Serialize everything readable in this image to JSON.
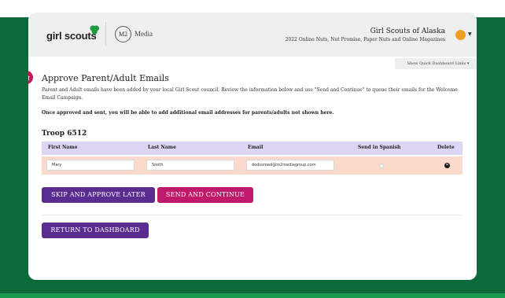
{
  "header": {
    "logo_text": "girl scouts",
    "partner_mark": "M2",
    "partner_name": "Media",
    "council": "Girl Scouts of Alaska",
    "sale_info": "2022 Online Nuts, Nut Promise, Paper Nuts and Online Magazines",
    "quick_links": "Show Quick Dashboard Links ▾"
  },
  "page": {
    "title": "Approve Parent/Adult Emails",
    "description": "Parent and Adult emails have been added by your local Girl Scout council. Review the information below and use \"Send and Continue\" to queue their emails for the Welcome Email Campaign.",
    "note": "Once approved and sent, you will be able to add additional email addresses for parents/adults not shown here."
  },
  "troop": {
    "label": "Troop 6512"
  },
  "table": {
    "headers": [
      "First Name",
      "Last Name",
      "Email",
      "Send in Spanish",
      "Delete"
    ],
    "rows": [
      {
        "first_name": "Mary",
        "last_name": "Smith",
        "email": "dodsomed@m2mediagroup.com",
        "send_in_spanish": false
      }
    ]
  },
  "buttons": {
    "skip": "SKIP AND APPROVE LATER",
    "send": "SEND AND CONTINUE",
    "return": "RETURN TO DASHBOARD"
  },
  "colors": {
    "brand_green": "#0c6a3a",
    "purple": "#5b2c8f",
    "magenta": "#c0186a",
    "header_row": "#dcd5f4",
    "data_row": "#fbd9cb"
  }
}
